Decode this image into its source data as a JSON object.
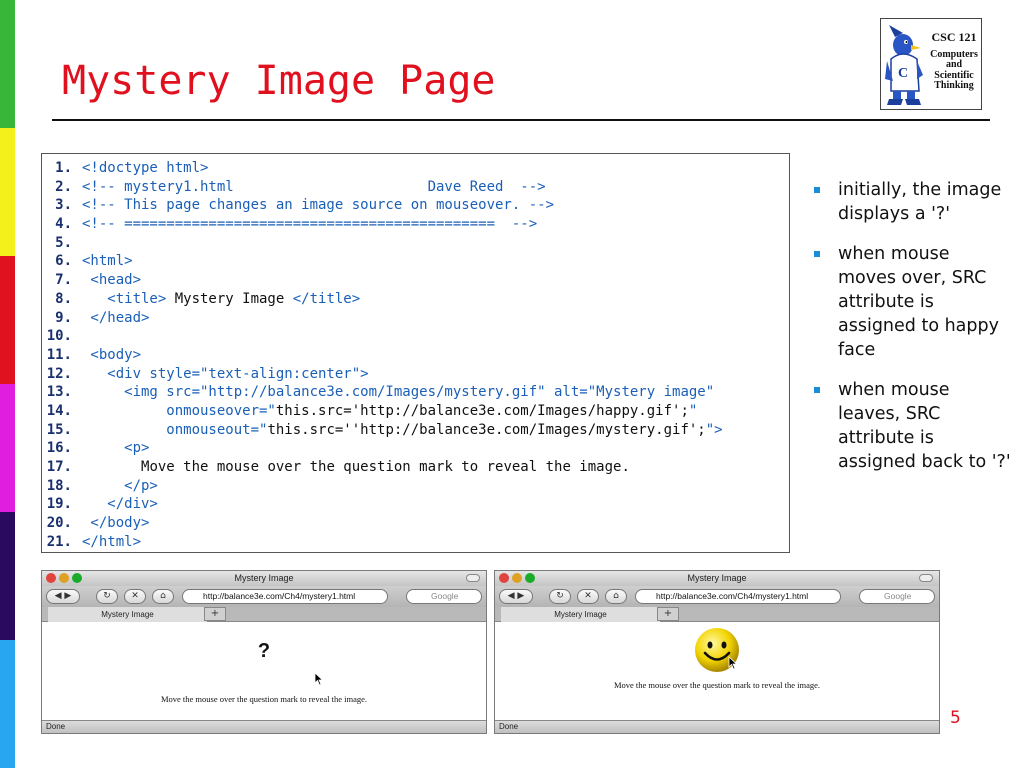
{
  "slide": {
    "title": "Mystery Image Page",
    "page_number": "5",
    "stripe_colors": [
      "#38b63a",
      "#f4f01c",
      "#e0121f",
      "#e01ee0",
      "#2a0a5e",
      "#28a6f0"
    ]
  },
  "logo": {
    "course": "CSC 121",
    "subtitle_lines": [
      "Computers",
      "and",
      "Scientific",
      "Thinking"
    ]
  },
  "code_lines": [
    {
      "n": "1.",
      "text": "<!doctype html>"
    },
    {
      "n": "2.",
      "text": "<!-- mystery1.html                       Dave Reed  -->"
    },
    {
      "n": "3.",
      "text": "<!-- This page changes an image source on mouseover. -->"
    },
    {
      "n": "4.",
      "text": "<!-- ============================================  -->"
    },
    {
      "n": "5.",
      "text": ""
    },
    {
      "n": "6.",
      "text": "<html>"
    },
    {
      "n": "7.",
      "text": " <head>"
    },
    {
      "n": "8.",
      "text": "   <title> ",
      "inner": "Mystery Image",
      "after": " </title>"
    },
    {
      "n": "9.",
      "text": " </head>"
    },
    {
      "n": "10.",
      "text": ""
    },
    {
      "n": "11.",
      "text": " <body>"
    },
    {
      "n": "12.",
      "text": "   <div style=\"text-align:center\">"
    },
    {
      "n": "13.",
      "text": "     <img src=\"http://balance3e.com/Images/mystery.gif\" alt=\"Mystery image\""
    },
    {
      "n": "14.",
      "text": "          onmouseover=\"",
      "inner": "this.src='http://balance3e.com/Images/happy.gif';",
      "after": "\""
    },
    {
      "n": "15.",
      "text": "          onmouseout=\"",
      "inner": "this.src=''http://balance3e.com/Images/mystery.gif';",
      "after": "\">"
    },
    {
      "n": "16.",
      "text": "     <p>"
    },
    {
      "n": "17.",
      "text": "       ",
      "inner": "Move the mouse over the question mark to reveal the image.",
      "after": ""
    },
    {
      "n": "18.",
      "text": "     </p>"
    },
    {
      "n": "19.",
      "text": "   </div>"
    },
    {
      "n": "20.",
      "text": " </body>"
    },
    {
      "n": "21.",
      "text": "</html>"
    }
  ],
  "bullets": [
    "initially, the image displays a '?'",
    "when mouse moves over, SRC attribute is assigned to happy face",
    "when mouse leaves, SRC attribute is assigned back to '?'"
  ],
  "browser_left": {
    "window_title": "Mystery Image",
    "url": "http://balance3e.com/Ch4/mystery1.html",
    "search_placeholder": "Google",
    "tab_label": "Mystery Image",
    "tab_plus": "+",
    "content_symbol": "?",
    "caption": "Move the mouse over the question mark to reveal the image.",
    "status": "Done"
  },
  "browser_right": {
    "window_title": "Mystery Image",
    "url": "http://balance3e.com/Ch4/mystery1.html",
    "search_placeholder": "Google",
    "tab_label": "Mystery Image",
    "tab_plus": "+",
    "caption": "Move the mouse over the question mark to reveal the image.",
    "status": "Done"
  }
}
